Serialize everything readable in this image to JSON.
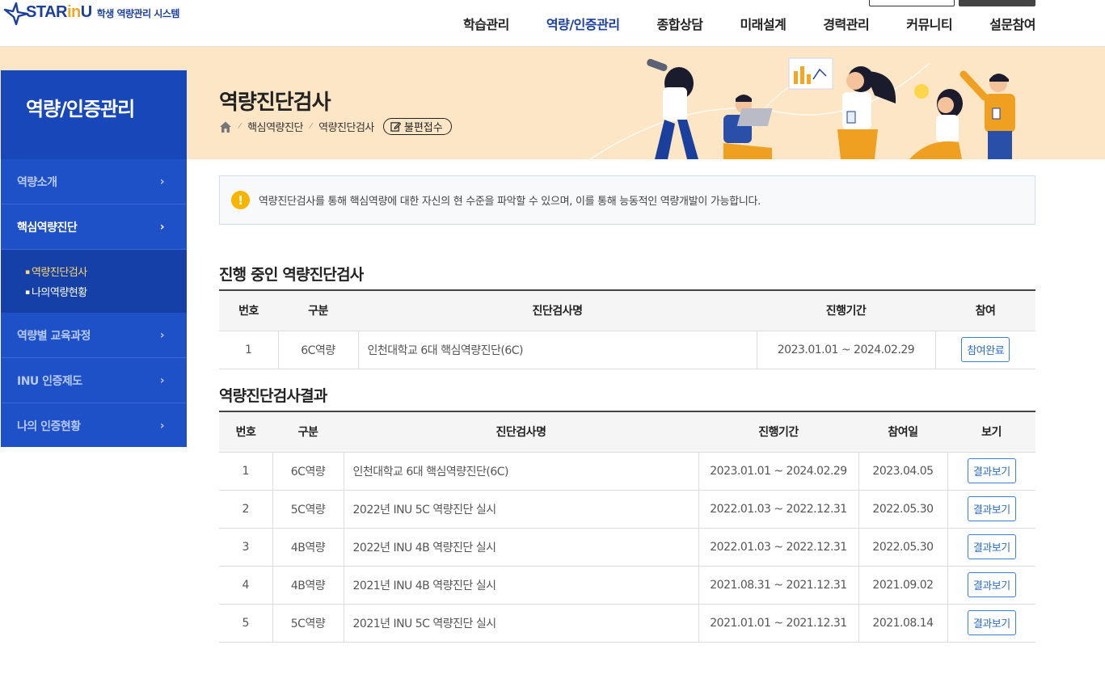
{
  "header": {
    "logo": {
      "star": "STAR",
      "in": "in",
      "u": "U",
      "subtitle": "학생 역량관리 시스템"
    },
    "nav": [
      {
        "label": "학습관리",
        "active": false
      },
      {
        "label": "역량/인증관리",
        "active": true
      },
      {
        "label": "종합상담",
        "active": false
      },
      {
        "label": "미래설계",
        "active": false
      },
      {
        "label": "경력관리",
        "active": false
      },
      {
        "label": "커뮤니티",
        "active": false
      },
      {
        "label": "설문참여",
        "active": false
      }
    ]
  },
  "sidebar": {
    "title": "역량/인증관리",
    "items": [
      {
        "label": "역량소개"
      },
      {
        "label": "핵심역량진단"
      },
      {
        "label": "역량별 교육과정"
      },
      {
        "label": "INU 인증제도"
      },
      {
        "label": "나의 인증현황"
      }
    ],
    "sub_items": [
      {
        "label": "역량진단검사"
      },
      {
        "label": "나의역량현황"
      }
    ]
  },
  "page": {
    "title": "역량진단검사",
    "breadcrumb": [
      "핵심역량진단",
      "역량진단검사"
    ],
    "report_button": "불편접수",
    "notice": "역량진단검사를 통해 핵심역량에 대한 자신의 현 수준을 파악할 수 있으며, 이를 통해 능동적인 역량개발이 가능합니다."
  },
  "ongoing": {
    "title": "진행 중인 역량진단검사",
    "headers": [
      "번호",
      "구분",
      "진단검사명",
      "진행기간",
      "참여"
    ],
    "rows": [
      {
        "no": "1",
        "type": "6C역량",
        "name": "인천대학교 6대 핵심역량진단(6C)",
        "period": "2023.01.01 ~ 2024.02.29",
        "action": "참여완료"
      }
    ]
  },
  "results": {
    "title": "역량진단검사결과",
    "headers": [
      "번호",
      "구분",
      "진단검사명",
      "진행기간",
      "참여일",
      "보기"
    ],
    "rows": [
      {
        "no": "1",
        "type": "6C역량",
        "name": "인천대학교 6대 핵심역량진단(6C)",
        "period": "2023.01.01 ~ 2024.02.29",
        "date": "2023.04.05",
        "action": "결과보기"
      },
      {
        "no": "2",
        "type": "5C역량",
        "name": "2022년 INU 5C 역량진단 실시",
        "period": "2022.01.03 ~ 2022.12.31",
        "date": "2022.05.30",
        "action": "결과보기"
      },
      {
        "no": "3",
        "type": "4B역량",
        "name": "2022년 INU 4B 역량진단 실시",
        "period": "2022.01.03 ~ 2022.12.31",
        "date": "2022.05.30",
        "action": "결과보기"
      },
      {
        "no": "4",
        "type": "4B역량",
        "name": "2021년 INU 4B 역량진단 실시",
        "period": "2021.08.31 ~ 2021.12.31",
        "date": "2021.09.02",
        "action": "결과보기"
      },
      {
        "no": "5",
        "type": "5C역량",
        "name": "2021년 INU 5C 역량진단 실시",
        "period": "2021.01.01 ~ 2021.12.31",
        "date": "2021.08.14",
        "action": "결과보기"
      }
    ]
  },
  "colors": {
    "brand": "#1a3f9c",
    "sidebar": "#1e50c7",
    "banner": "#fde6c6",
    "accent": "#f7b500",
    "button": "#2b6cc4"
  }
}
